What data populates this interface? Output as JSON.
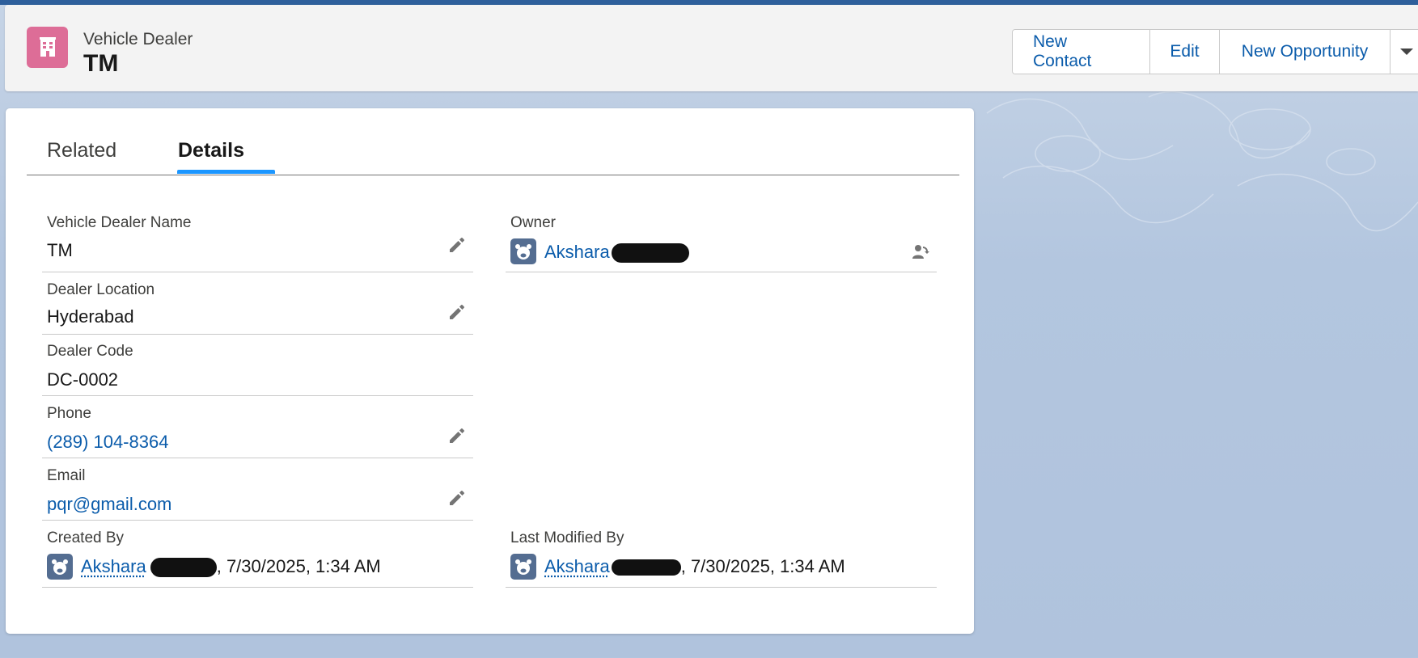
{
  "header": {
    "object_type": "Vehicle Dealer",
    "record_name": "TM",
    "actions": [
      "New Contact",
      "Edit",
      "New Opportunity"
    ]
  },
  "tabs": [
    {
      "label": "Related",
      "active": false
    },
    {
      "label": "Details",
      "active": true
    }
  ],
  "fields": {
    "dealer_name": {
      "label": "Vehicle Dealer Name",
      "value": "TM"
    },
    "location": {
      "label": "Dealer Location",
      "value": "Hyderabad"
    },
    "code": {
      "label": "Dealer Code",
      "value": "DC-0002"
    },
    "phone": {
      "label": "Phone",
      "value": "(289) 104-8364"
    },
    "email": {
      "label": "Email",
      "value": "pqr@gmail.com"
    },
    "owner": {
      "label": "Owner",
      "user": "Akshara"
    },
    "created_by": {
      "label": "Created By",
      "user": "Akshara",
      "timestamp": ", 7/30/2025, 1:34 AM"
    },
    "last_modified_by": {
      "label": "Last Modified By",
      "user": "Akshara",
      "timestamp": ", 7/30/2025, 1:34 AM"
    }
  },
  "colors": {
    "object_icon": "#dd6d97",
    "link": "#0b5cab",
    "tab_active": "#1b96ff",
    "avatar": "#546d91"
  },
  "icons": [
    "building-icon",
    "pencil-icon",
    "user-avatar-icon",
    "change-owner-icon",
    "chevron-down-icon"
  ]
}
